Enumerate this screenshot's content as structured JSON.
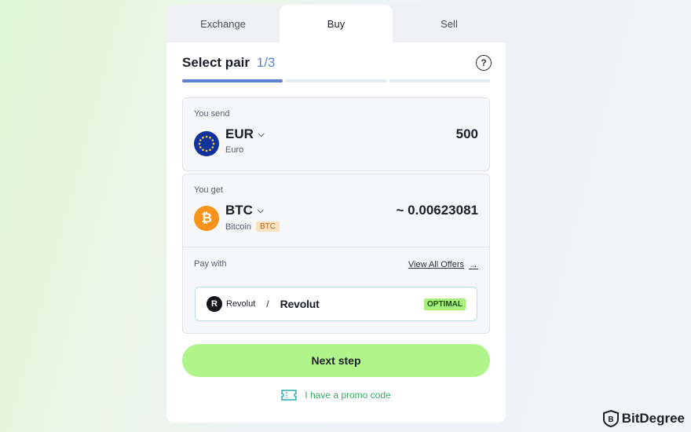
{
  "tabs": [
    {
      "label": "Exchange",
      "active": false
    },
    {
      "label": "Buy",
      "active": true
    },
    {
      "label": "Sell",
      "active": false
    }
  ],
  "header": {
    "title": "Select pair",
    "step": "1/3",
    "steps_total": 3,
    "steps_done": 1
  },
  "send": {
    "label": "You send",
    "currency": "EUR",
    "currency_name": "Euro",
    "amount": "500",
    "icon": "eu-flag-icon"
  },
  "get": {
    "label": "You get",
    "currency": "BTC",
    "currency_name": "Bitcoin",
    "network_tag": "BTC",
    "amount": "~ 0.00623081",
    "icon": "bitcoin-icon"
  },
  "payment": {
    "label": "Pay with",
    "view_all": "View All Offers",
    "provider_small": "Revolut",
    "separator": "/",
    "provider_name": "Revolut",
    "badge": "OPTIMAL"
  },
  "actions": {
    "next": "Next step",
    "promo": "I have a promo code"
  },
  "brand": {
    "name": "BitDegree"
  },
  "colors": {
    "accent": "#5f84d6",
    "primary_button": "#b0f58a",
    "promo_text": "#3aae63",
    "bitcoin": "#f7931a"
  }
}
